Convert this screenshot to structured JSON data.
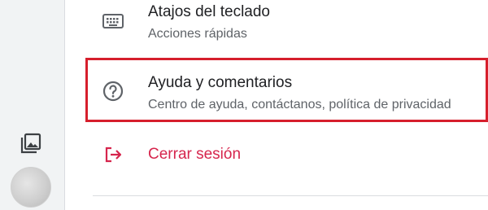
{
  "menu": {
    "items": [
      {
        "icon": "keyboard-icon",
        "title": "Atajos del teclado",
        "subtitle": "Acciones rápidas"
      },
      {
        "icon": "help-icon",
        "title": "Ayuda y comentarios",
        "subtitle": "Centro de ayuda, contáctanos, política de privacidad"
      },
      {
        "icon": "logout-icon",
        "title": "Cerrar sesión"
      }
    ]
  },
  "colors": {
    "highlight_border": "#d61f2c",
    "logout": "#d6254d",
    "icon": "#5f6368",
    "text_primary": "#202124",
    "text_secondary": "#5f6368"
  },
  "left_rail": {
    "icons": [
      "photo-library-icon",
      "avatar"
    ]
  }
}
